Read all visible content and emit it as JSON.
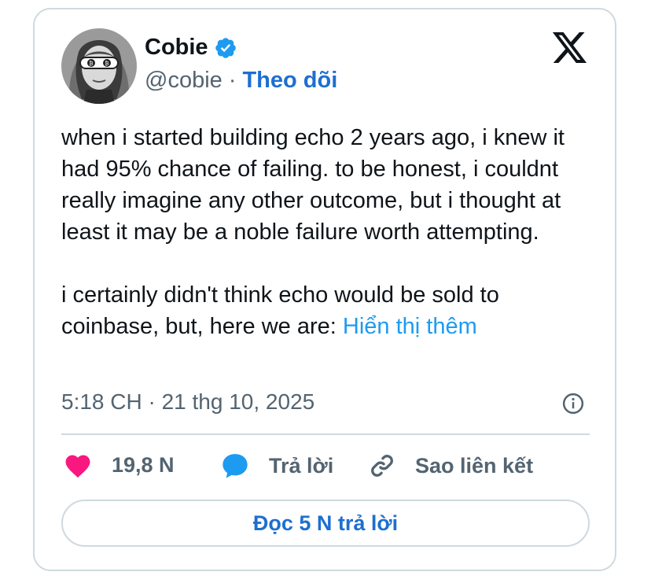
{
  "author": {
    "display_name": "Cobie",
    "handle": "@cobie",
    "separator": "·",
    "follow_label": "Theo dõi",
    "verified": true
  },
  "tweet": {
    "paragraph1": "when i started building echo 2 years ago, i knew it had 95% chance of failing. to be honest, i couldnt really imagine any other outcome, but i thought at least it may be a noble failure worth attempting.",
    "paragraph2": "i certainly didn't think echo would be sold to coinbase, but, here we are:",
    "show_more_label": "Hiển thị thêm",
    "timestamp": "5:18 CH · 21 thg 10, 2025"
  },
  "actions": {
    "like_count": "19,8 N",
    "reply_label": "Trả lời",
    "copy_link_label": "Sao liên kết",
    "read_replies_label": "Đọc 5 N trả lời"
  },
  "icons": {
    "brand": "x-logo-icon",
    "verified": "verified-badge-icon",
    "info": "info-icon",
    "like": "heart-icon",
    "reply": "speech-bubble-icon",
    "copy": "link-icon"
  },
  "colors": {
    "link_blue": "#1d9bf0",
    "follow_blue": "#1d6fd0",
    "heart_pink": "#f91880",
    "text_primary": "#0f1419",
    "text_secondary": "#536471",
    "border": "#cfd9de"
  }
}
